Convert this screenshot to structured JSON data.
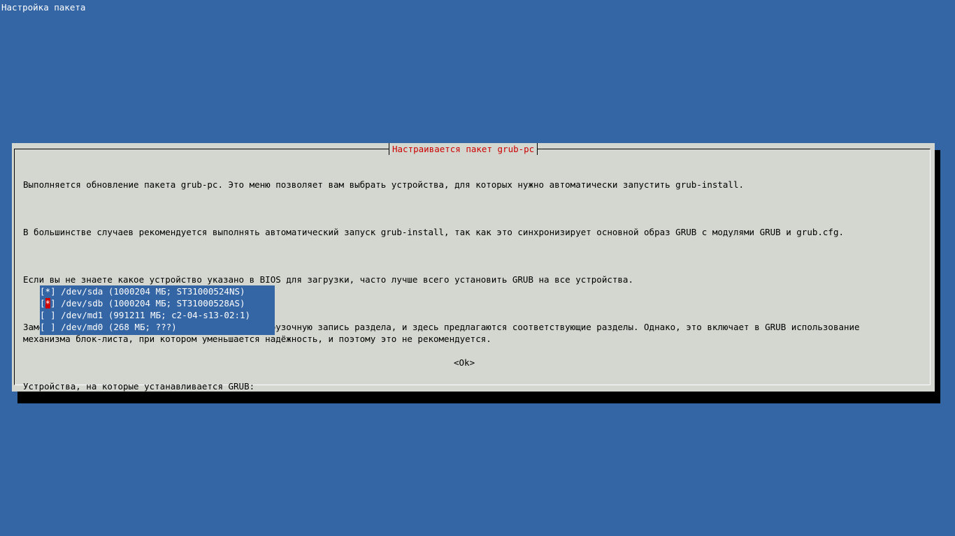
{
  "screen": {
    "title": "Настройка пакета"
  },
  "dialog": {
    "title": "Настраивается пакет grub-pc",
    "paragraphs": [
      "Выполняется обновление пакета grub-pc. Это меню позволяет вам выбрать устройства, для которых нужно автоматически запустить grub-install.",
      "В большинстве случаев рекомендуется выполнять автоматический запуск grub-install, так как это синхронизирует основной образ GRUB с модулями GRUB и grub.cfg.",
      "Если вы не знаете какое устройство указано в BIOS для загрузки, часто лучше всего установить GRUB на все устройства.",
      "Замечание: также возможно установить GRUB в загрузочную запись раздела, и здесь предлагаются соответствующие разделы. Однако, это включает в GRUB использование\nмеханизма блок-листа, при котором уменьшается надёжность, и поэтому это не рекомендуется.",
      "Устройства, на которые устанавливается GRUB:"
    ],
    "devices": [
      {
        "checkbox_open": "[",
        "mark": "*",
        "checkbox_close": "]",
        "label": " /dev/sda (1000204 МБ; ST31000524NS)"
      },
      {
        "checkbox_open": "[",
        "mark": "*",
        "checkbox_close": "]",
        "label": " /dev/sdb (1000204 МБ; ST31000528AS)"
      },
      {
        "checkbox_open": "[",
        "mark": " ",
        "checkbox_close": "]",
        "label": " /dev/md1 (991211 МБ; c2-04-s13-02:1)"
      },
      {
        "checkbox_open": "[",
        "mark": " ",
        "checkbox_close": "]",
        "label": " /dev/md0 (268 МБ; ???)"
      }
    ],
    "ok_label": "<Ok>"
  },
  "colors": {
    "background": "#3465a4",
    "dialog": "#d3d7cf",
    "title_accent": "#cc0000",
    "focus_mark": "#cc0000"
  }
}
